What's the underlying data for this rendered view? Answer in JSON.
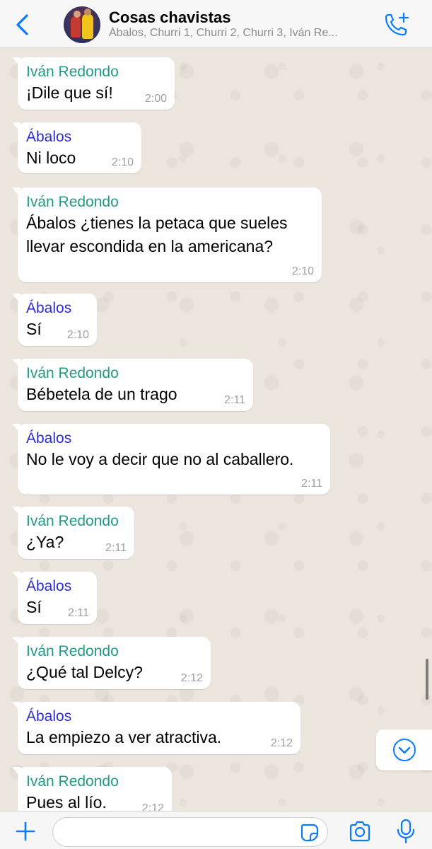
{
  "colors": {
    "accent": "#0a7bff",
    "sender_ivan": "#1f9b86",
    "sender_abalos": "#2c2bcf",
    "bubble": "#ffffff",
    "chat_bg": "#ece5dd"
  },
  "header": {
    "title": "Cosas chavistas",
    "subtitle": "Ábalos, Churri 1, Churri 2, Churri 3, Iván Re...",
    "back_icon": "chevron-left-icon",
    "call_icon": "add-call-icon"
  },
  "messages": [
    {
      "sender": "Iván Redondo",
      "lines": [
        "¡Dile que sí!"
      ],
      "time": "2:00"
    },
    {
      "sender": "Ábalos",
      "lines": [
        "Ni loco"
      ],
      "time": "2:10"
    },
    {
      "sender": "Iván Redondo",
      "lines": [
        "Ábalos ¿tienes la petaca que sueles",
        "llevar escondida en la americana?"
      ],
      "time": "2:10"
    },
    {
      "sender": "Ábalos",
      "lines": [
        "Sí"
      ],
      "time": "2:10"
    },
    {
      "sender": "Iván Redondo",
      "lines": [
        "Bébetela de un trago"
      ],
      "time": "2:11"
    },
    {
      "sender": "Ábalos",
      "lines": [
        "No le voy a decir que no al caballero."
      ],
      "time": "2:11"
    },
    {
      "sender": "Iván Redondo",
      "lines": [
        "¿Ya?"
      ],
      "time": "2:11"
    },
    {
      "sender": "Ábalos",
      "lines": [
        "Sí"
      ],
      "time": "2:11"
    },
    {
      "sender": "Iván Redondo",
      "lines": [
        "¿Qué tal Delcy?"
      ],
      "time": "2:12"
    },
    {
      "sender": "Ábalos",
      "lines": [
        "La empiezo a ver atractiva."
      ],
      "time": "2:12"
    },
    {
      "sender": "Iván Redondo",
      "lines": [
        "Pues al lío."
      ],
      "time": "2:12"
    }
  ],
  "input": {
    "placeholder": "",
    "icons": [
      "plus-icon",
      "sticker-icon",
      "camera-icon",
      "microphone-icon"
    ]
  },
  "scroll_down_icon": "chevron-down-circle-icon"
}
